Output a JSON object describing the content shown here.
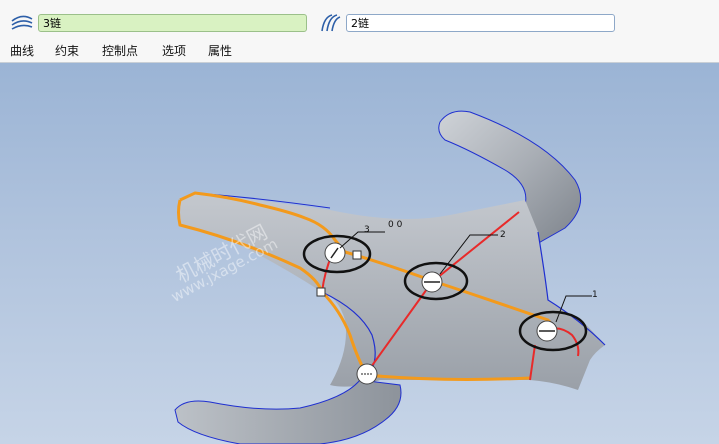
{
  "toolbar": {
    "chain1": {
      "icon": "chain-curve-icon",
      "value": "3链"
    },
    "chain2": {
      "icon": "chain-curve-icon",
      "value": "2链"
    }
  },
  "menu": {
    "items": [
      {
        "label": "曲线"
      },
      {
        "label": "约束"
      },
      {
        "label": "控制点"
      },
      {
        "label": "选项"
      },
      {
        "label": "属性"
      }
    ]
  },
  "viewport": {
    "labels": {
      "c1": "1",
      "c2": "2",
      "c3": "3",
      "c00": "0 0"
    },
    "watermark": {
      "line1": "机械时代网",
      "line2": "www.jxage.com"
    }
  },
  "colors": {
    "surface": "#a8acb2",
    "boundary": "#1f2fd0",
    "chain3": "#f39a1c",
    "chain2": "#e82a2a",
    "highlight": "#111111"
  }
}
